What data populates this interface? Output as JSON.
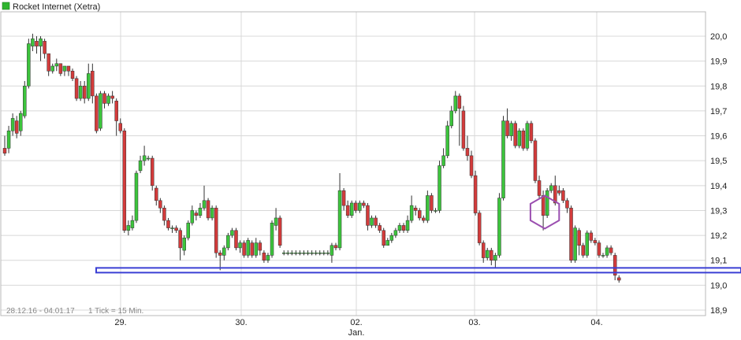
{
  "legend": {
    "label": "Rocket Internet (Xetra)",
    "color": "#2fb52f"
  },
  "footer": {
    "range": "28.12.16 - 04.01.17",
    "tick": "1 Tick = 15 Min."
  },
  "colors": {
    "up": "#3cc43c",
    "down": "#d33b3b",
    "grid": "#d8d8d8",
    "support_line": "#3a3fd4",
    "marker": "#9b4fb0"
  },
  "chart_data": {
    "type": "candlestick",
    "title": "Rocket Internet (Xetra)",
    "ylim": [
      18.9,
      20.05
    ],
    "y_ticks": [
      "20,0",
      "19,9",
      "19,8",
      "19,7",
      "19,6",
      "19,5",
      "19,4",
      "19,3",
      "19,2",
      "19,1",
      "19,0",
      "18,9"
    ],
    "x_ticks": [
      {
        "label": "29.",
        "sublabel": ""
      },
      {
        "label": "30.",
        "sublabel": ""
      },
      {
        "label": "02.",
        "sublabel": "Jan."
      },
      {
        "label": "03.",
        "sublabel": ""
      },
      {
        "label": "04.",
        "sublabel": ""
      }
    ],
    "support_level": 19.06,
    "marked_candle_index": 135,
    "candles": [
      [
        19.55,
        19.53,
        19.6,
        19.52
      ],
      [
        19.55,
        19.62,
        19.64,
        19.53
      ],
      [
        19.62,
        19.67,
        19.69,
        19.6
      ],
      [
        19.66,
        19.61,
        19.68,
        19.59
      ],
      [
        19.62,
        19.69,
        19.7,
        19.6
      ],
      [
        19.68,
        19.8,
        19.82,
        19.67
      ],
      [
        19.8,
        19.97,
        19.99,
        19.79
      ],
      [
        19.96,
        19.99,
        20.01,
        19.94
      ],
      [
        19.98,
        19.96,
        20.0,
        19.93
      ],
      [
        19.96,
        19.99,
        20.0,
        19.9
      ],
      [
        19.98,
        19.93,
        19.99,
        19.91
      ],
      [
        19.93,
        19.86,
        19.93,
        19.84
      ],
      [
        19.86,
        19.88,
        19.89,
        19.85
      ],
      [
        19.88,
        19.89,
        19.91,
        19.86
      ],
      [
        19.89,
        19.85,
        19.89,
        19.84
      ],
      [
        19.86,
        19.88,
        19.88,
        19.84
      ],
      [
        19.88,
        19.86,
        19.88,
        19.84
      ],
      [
        19.86,
        19.83,
        19.87,
        19.82
      ],
      [
        19.83,
        19.75,
        19.84,
        19.74
      ],
      [
        19.75,
        19.8,
        19.82,
        19.74
      ],
      [
        19.8,
        19.75,
        19.82,
        19.73
      ],
      [
        19.75,
        19.85,
        19.89,
        19.74
      ],
      [
        19.86,
        19.76,
        19.89,
        19.73
      ],
      [
        19.76,
        19.62,
        19.77,
        19.61
      ],
      [
        19.63,
        19.77,
        19.78,
        19.62
      ],
      [
        19.77,
        19.73,
        19.78,
        19.71
      ],
      [
        19.73,
        19.76,
        19.77,
        19.72
      ],
      [
        19.76,
        19.75,
        19.78,
        19.73
      ],
      [
        19.74,
        19.66,
        19.75,
        19.6
      ],
      [
        19.65,
        19.62,
        19.67,
        19.61
      ],
      [
        19.62,
        19.22,
        19.63,
        19.21
      ],
      [
        19.22,
        19.24,
        19.26,
        19.2
      ],
      [
        19.23,
        19.26,
        19.28,
        19.22
      ],
      [
        19.26,
        19.45,
        19.46,
        19.25
      ],
      [
        19.46,
        19.5,
        19.52,
        19.45
      ],
      [
        19.5,
        19.52,
        19.56,
        19.48
      ],
      [
        19.51,
        19.51,
        19.52,
        19.5
      ],
      [
        19.51,
        19.4,
        19.52,
        19.38
      ],
      [
        19.39,
        19.34,
        19.4,
        19.32
      ],
      [
        19.34,
        19.31,
        19.35,
        19.29
      ],
      [
        19.31,
        19.26,
        19.32,
        19.24
      ],
      [
        19.26,
        19.23,
        19.27,
        19.22
      ],
      [
        19.23,
        19.23,
        19.24,
        19.21
      ],
      [
        19.23,
        19.22,
        19.24,
        19.21
      ],
      [
        19.22,
        19.15,
        19.23,
        19.1
      ],
      [
        19.14,
        19.19,
        19.2,
        19.12
      ],
      [
        19.19,
        19.25,
        19.26,
        19.18
      ],
      [
        19.25,
        19.3,
        19.32,
        19.24
      ],
      [
        19.29,
        19.28,
        19.3,
        19.26
      ],
      [
        19.28,
        19.31,
        19.33,
        19.27
      ],
      [
        19.31,
        19.34,
        19.4,
        19.3
      ],
      [
        19.34,
        19.27,
        19.35,
        19.26
      ],
      [
        19.27,
        19.31,
        19.32,
        19.26
      ],
      [
        19.31,
        19.13,
        19.32,
        19.11
      ],
      [
        19.13,
        19.12,
        19.14,
        19.06
      ],
      [
        19.12,
        19.15,
        19.16,
        19.1
      ],
      [
        19.15,
        19.2,
        19.21,
        19.14
      ],
      [
        19.2,
        19.22,
        19.23,
        19.19
      ],
      [
        19.22,
        19.15,
        19.23,
        19.14
      ],
      [
        19.15,
        19.17,
        19.18,
        19.13
      ],
      [
        19.17,
        19.12,
        19.18,
        19.11
      ],
      [
        19.12,
        19.18,
        19.19,
        19.11
      ],
      [
        19.17,
        19.12,
        19.18,
        19.11
      ],
      [
        19.12,
        19.17,
        19.19,
        19.11
      ],
      [
        19.17,
        19.14,
        19.18,
        19.12
      ],
      [
        19.13,
        19.1,
        19.14,
        19.09
      ],
      [
        19.1,
        19.12,
        19.13,
        19.09
      ],
      [
        19.12,
        19.25,
        19.26,
        19.11
      ],
      [
        19.24,
        19.27,
        19.31,
        19.22
      ],
      [
        19.27,
        19.16,
        19.28,
        19.15
      ],
      [
        19.13,
        19.13,
        19.14,
        19.12
      ],
      [
        19.13,
        19.13,
        19.14,
        19.12
      ],
      [
        19.13,
        19.13,
        19.14,
        19.12
      ],
      [
        19.13,
        19.13,
        19.14,
        19.12
      ],
      [
        19.13,
        19.13,
        19.14,
        19.12
      ],
      [
        19.13,
        19.13,
        19.14,
        19.12
      ],
      [
        19.13,
        19.13,
        19.14,
        19.12
      ],
      [
        19.13,
        19.13,
        19.14,
        19.12
      ],
      [
        19.13,
        19.13,
        19.14,
        19.12
      ],
      [
        19.13,
        19.13,
        19.14,
        19.12
      ],
      [
        19.13,
        19.13,
        19.14,
        19.12
      ],
      [
        19.13,
        19.13,
        19.14,
        19.12
      ],
      [
        19.12,
        19.16,
        19.17,
        19.09
      ],
      [
        19.16,
        19.15,
        19.17,
        19.14
      ],
      [
        19.15,
        19.38,
        19.45,
        19.14
      ],
      [
        19.38,
        19.32,
        19.39,
        19.3
      ],
      [
        19.32,
        19.28,
        19.34,
        19.27
      ],
      [
        19.28,
        19.33,
        19.34,
        19.27
      ],
      [
        19.33,
        19.3,
        19.34,
        19.29
      ],
      [
        19.3,
        19.33,
        19.34,
        19.29
      ],
      [
        19.33,
        19.32,
        19.34,
        19.31
      ],
      [
        19.32,
        19.24,
        19.33,
        19.22
      ],
      [
        19.24,
        19.27,
        19.28,
        19.23
      ],
      [
        19.27,
        19.24,
        19.28,
        19.23
      ],
      [
        19.24,
        19.22,
        19.25,
        19.21
      ],
      [
        19.22,
        19.16,
        19.23,
        19.15
      ],
      [
        19.16,
        19.18,
        19.19,
        19.16
      ],
      [
        19.18,
        19.2,
        19.21,
        19.17
      ],
      [
        19.2,
        19.22,
        19.23,
        19.19
      ],
      [
        19.22,
        19.24,
        19.25,
        19.21
      ],
      [
        19.24,
        19.22,
        19.25,
        19.21
      ],
      [
        19.22,
        19.26,
        19.28,
        19.21
      ],
      [
        19.26,
        19.32,
        19.36,
        19.25
      ],
      [
        19.31,
        19.3,
        19.32,
        19.28
      ],
      [
        19.3,
        19.27,
        19.31,
        19.26
      ],
      [
        19.27,
        19.26,
        19.28,
        19.25
      ],
      [
        19.26,
        19.36,
        19.38,
        19.25
      ],
      [
        19.36,
        19.3,
        19.37,
        19.29
      ],
      [
        19.3,
        19.3,
        19.31,
        19.29
      ],
      [
        19.3,
        19.48,
        19.5,
        19.29
      ],
      [
        19.48,
        19.52,
        19.55,
        19.47
      ],
      [
        19.52,
        19.64,
        19.66,
        19.51
      ],
      [
        19.64,
        19.7,
        19.72,
        19.63
      ],
      [
        19.7,
        19.76,
        19.78,
        19.69
      ],
      [
        19.76,
        19.71,
        19.77,
        19.56
      ],
      [
        19.7,
        19.55,
        19.72,
        19.54
      ],
      [
        19.55,
        19.52,
        19.6,
        19.5
      ],
      [
        19.52,
        19.44,
        19.54,
        19.43
      ],
      [
        19.44,
        19.29,
        19.46,
        19.28
      ],
      [
        19.29,
        19.17,
        19.3,
        19.16
      ],
      [
        19.17,
        19.11,
        19.18,
        19.09
      ],
      [
        19.11,
        19.14,
        19.15,
        19.1
      ],
      [
        19.14,
        19.1,
        19.15,
        19.08
      ],
      [
        19.1,
        19.12,
        19.13,
        19.07
      ],
      [
        19.12,
        19.35,
        19.37,
        19.11
      ],
      [
        19.35,
        19.66,
        19.68,
        19.34
      ],
      [
        19.66,
        19.6,
        19.71,
        19.59
      ],
      [
        19.6,
        19.65,
        19.66,
        19.58
      ],
      [
        19.65,
        19.56,
        19.66,
        19.55
      ],
      [
        19.56,
        19.62,
        19.63,
        19.55
      ],
      [
        19.62,
        19.55,
        19.63,
        19.54
      ],
      [
        19.55,
        19.65,
        19.66,
        19.54
      ],
      [
        19.65,
        19.58,
        19.66,
        19.57
      ],
      [
        19.58,
        19.42,
        19.59,
        19.41
      ],
      [
        19.42,
        19.36,
        19.44,
        19.35
      ],
      [
        19.36,
        19.28,
        19.38,
        19.22
      ],
      [
        19.28,
        19.38,
        19.39,
        19.27
      ],
      [
        19.38,
        19.4,
        19.41,
        19.37
      ],
      [
        19.4,
        19.33,
        19.44,
        19.32
      ],
      [
        19.38,
        19.37,
        19.4,
        19.36
      ],
      [
        19.38,
        19.34,
        19.39,
        19.33
      ],
      [
        19.34,
        19.31,
        19.35,
        19.29
      ],
      [
        19.31,
        19.1,
        19.32,
        19.09
      ],
      [
        19.1,
        19.23,
        19.24,
        19.09
      ],
      [
        19.22,
        19.16,
        19.23,
        19.12
      ],
      [
        19.16,
        19.12,
        19.17,
        19.11
      ],
      [
        19.12,
        19.21,
        19.22,
        19.11
      ],
      [
        19.21,
        19.18,
        19.22,
        19.17
      ],
      [
        19.18,
        19.17,
        19.19,
        19.16
      ],
      [
        19.17,
        19.12,
        19.18,
        19.11
      ],
      [
        19.12,
        19.12,
        19.13,
        19.11
      ],
      [
        19.12,
        19.15,
        19.16,
        19.11
      ],
      [
        19.15,
        19.13,
        19.16,
        19.12
      ],
      [
        19.12,
        19.04,
        19.13,
        19.02
      ],
      [
        19.03,
        19.02,
        19.04,
        19.01
      ]
    ]
  }
}
